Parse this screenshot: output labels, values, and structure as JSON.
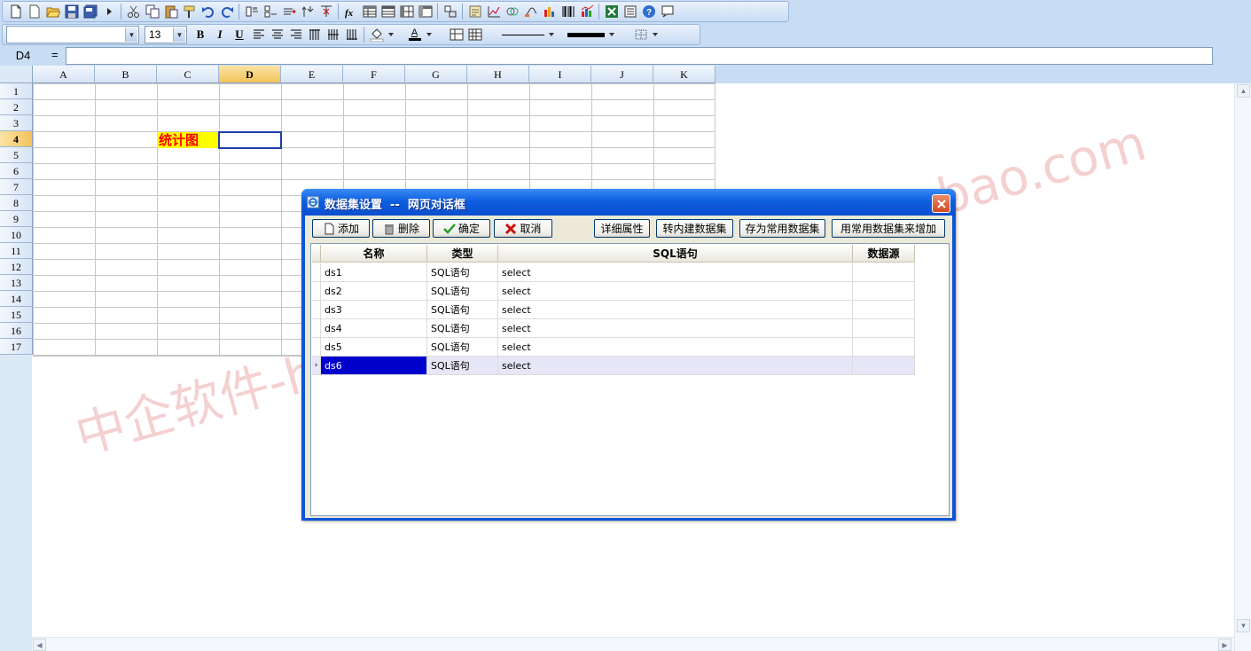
{
  "toolbar": {
    "row1_icons": [
      "new-icon",
      "new-blank-icon",
      "open-folder-icon",
      "save-icon",
      "save-all-icon",
      "run-icon",
      "cut-icon",
      "copy-icon",
      "paste-icon",
      "format-painter-icon",
      "undo-icon",
      "redo-icon",
      "insert-row-left-icon",
      "insert-row-below-icon",
      "insert-column-icon",
      "delete-row-icon",
      "delete-column-icon",
      "merge-icon",
      "function-icon",
      "table-style1-icon",
      "table-style2-icon",
      "table-style3-icon",
      "table-style4-icon",
      "sort-icon",
      "report-icon",
      "chart-icon",
      "link-icon",
      "image-icon",
      "bar-chart-icon",
      "barcode-icon",
      "statistics-chart-icon",
      "excel-icon",
      "properties-icon",
      "help-icon",
      "message-icon"
    ],
    "font_name": "",
    "font_size": "13",
    "bold_label": "B",
    "italic_label": "I",
    "underline_label": "U",
    "font_color_label": "A"
  },
  "formula_bar": {
    "cell_ref": "D4",
    "equals": "=",
    "formula": ""
  },
  "sheet": {
    "columns": [
      "A",
      "B",
      "C",
      "D",
      "E",
      "F",
      "G",
      "H",
      "I",
      "J",
      "K"
    ],
    "rows": [
      "1",
      "2",
      "3",
      "4",
      "5",
      "6",
      "7",
      "8",
      "9",
      "10",
      "11",
      "12",
      "13",
      "14",
      "15",
      "16",
      "17"
    ],
    "active_column": "D",
    "active_row": "4",
    "cell_c4": "统计图"
  },
  "dialog": {
    "title": "数据集设置  --  网页对话框",
    "buttons": {
      "add": "添加",
      "delete": "删除",
      "ok": "确定",
      "cancel": "取消",
      "details": "详细属性",
      "convert_builtin": "转内建数据集",
      "save_common": "存为常用数据集",
      "add_from_common": "用常用数据集来增加"
    },
    "table": {
      "headers": {
        "name": "名称",
        "type": "类型",
        "sql": "SQL语句",
        "datasource": "数据源"
      },
      "rows": [
        {
          "name": "ds1",
          "type": "SQL语句",
          "sql": "select",
          "datasource": ""
        },
        {
          "name": "ds2",
          "type": "SQL语句",
          "sql": "select",
          "datasource": ""
        },
        {
          "name": "ds3",
          "type": "SQL语句",
          "sql": "select",
          "datasource": ""
        },
        {
          "name": "ds4",
          "type": "SQL语句",
          "sql": "select",
          "datasource": ""
        },
        {
          "name": "ds5",
          "type": "SQL语句",
          "sql": "select",
          "datasource": ""
        },
        {
          "name": "ds6",
          "type": "SQL语句",
          "sql": "select",
          "datasource": ""
        }
      ],
      "selected_row": "ds6",
      "selected_marker": "›"
    }
  },
  "watermark": "中企软件-https://shop113983773.taobao.com",
  "colors": {
    "dialog_blue": "#0a55d8",
    "selection_blue": "#0000cc",
    "highlight_yellow": "#ffff00",
    "highlight_red": "#ff0000"
  }
}
